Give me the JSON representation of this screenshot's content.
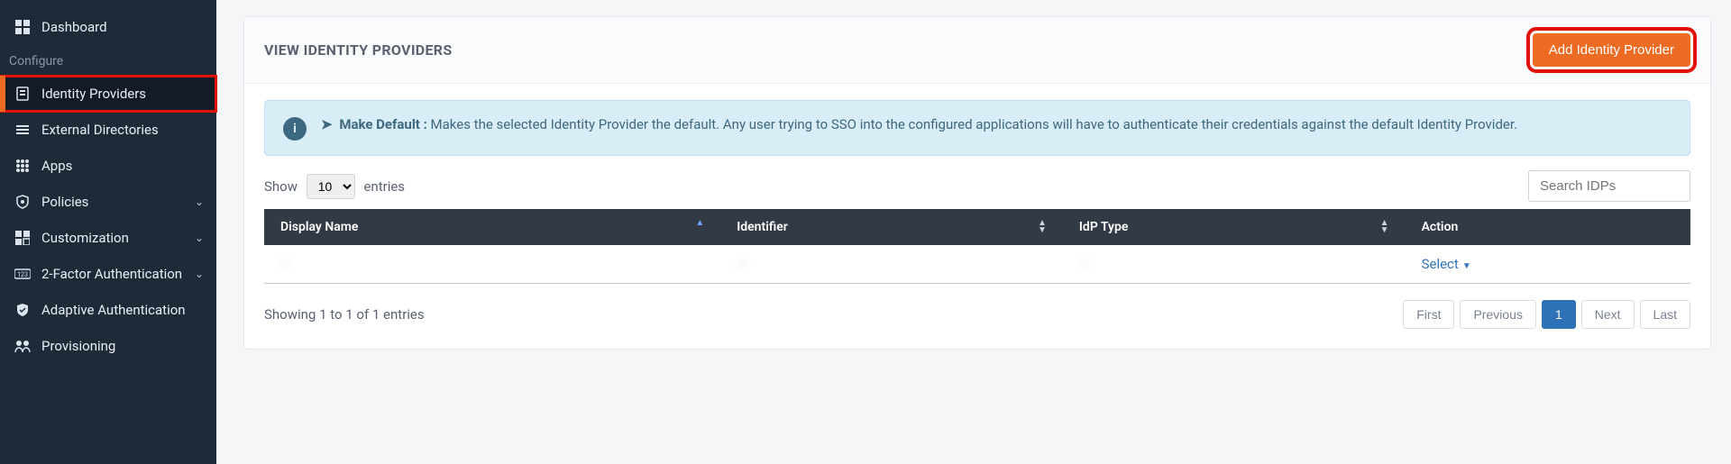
{
  "sidebar": {
    "items": [
      {
        "label": "Dashboard"
      }
    ],
    "section_label": "Configure",
    "config_items": [
      {
        "label": "Identity Providers"
      },
      {
        "label": "External Directories"
      },
      {
        "label": "Apps"
      },
      {
        "label": "Policies"
      },
      {
        "label": "Customization"
      },
      {
        "label": "2-Factor Authentication"
      },
      {
        "label": "Adaptive Authentication"
      },
      {
        "label": "Provisioning"
      }
    ]
  },
  "page": {
    "title": "VIEW IDENTITY PROVIDERS",
    "add_button": "Add Identity Provider",
    "info_title": "Make Default :",
    "info_text": "Makes the selected Identity Provider the default. Any user trying to SSO into the configured applications will have to authenticate their credentials against the default Identity Provider.",
    "show_label": "Show",
    "entries_label": "entries",
    "entries_options": [
      "10"
    ],
    "entries_selected": "10",
    "search_placeholder": "Search IDPs",
    "columns": {
      "display_name": "Display Name",
      "identifier": "Identifier",
      "idp_type": "IdP Type",
      "action": "Action"
    },
    "row": {
      "display_name": "—",
      "identifier": "—",
      "idp_type": "—",
      "action_label": "Select"
    },
    "footer_info": "Showing 1 to 1 of 1 entries",
    "pager": {
      "first": "First",
      "previous": "Previous",
      "page": "1",
      "next": "Next",
      "last": "Last"
    }
  }
}
